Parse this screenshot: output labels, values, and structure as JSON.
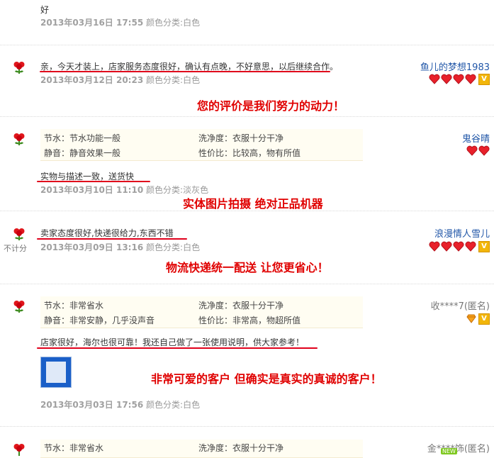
{
  "colors": {
    "promo_red": "#e00000",
    "underline_red": "#e0001b",
    "username_blue": "#2257a8",
    "meta_gray": "#999999"
  },
  "icons": {
    "reviewer_flower": "red-flower-icon",
    "heart_badge": "red-heart-icon",
    "vip_badge": "vip-icon",
    "diamond_badge": "diamond-icon"
  },
  "reviews": [
    {
      "content": "好",
      "date": "2013年03月16日 17:55",
      "color_label": "颜色分类:",
      "color_value": "白色"
    },
    {
      "content": "亲，今天才装上，店家服务态度很好，确认有点晚，不好意思，以后继续合作。",
      "date": "2013年03月12日 20:23",
      "color_label": "颜色分类:",
      "color_value": "白色",
      "user": "鱼儿的梦想1983",
      "promo": "您的评价是我们努力的动力！"
    },
    {
      "attrs": [
        {
          "label": "节水：节水功能一般"
        },
        {
          "label": "洗净度：衣服十分干净"
        },
        {
          "label": "静音：静音效果一般"
        },
        {
          "label": "性价比：比较高，物有所值"
        }
      ],
      "content": "实物与描述一致，送货快",
      "date": "2013年03月10日 11:10",
      "color_label": "颜色分类:",
      "color_value": "淡灰色",
      "user": "鬼谷晴",
      "promo": "实体图片拍摄 绝对正品机器"
    },
    {
      "content": "卖家态度很好,快递很给力,东西不错",
      "date": "2013年03月09日 13:16",
      "color_label": "颜色分类:",
      "color_value": "白色",
      "user": "浪漫情人雪儿",
      "points_note": "不计分",
      "promo": "物流快递统一配送 让您更省心！"
    },
    {
      "attrs": [
        {
          "label": "节水：非常省水"
        },
        {
          "label": "洗净度：衣服十分干净"
        },
        {
          "label": "静音：非常安静，几乎没声音"
        },
        {
          "label": "性价比：非常高，物超所值"
        }
      ],
      "content": "店家很好，海尔也很可靠！我还自己做了一张使用说明，供大家参考！",
      "date": "2013年03月03日 17:56",
      "color_label": "颜色分类:",
      "color_value": "白色",
      "user": "收****7(匿名)",
      "promo": "非常可爱的客户 但确实是真实的真诚的客户！"
    },
    {
      "attrs": [
        {
          "label": "节水：非常省水"
        },
        {
          "label": "洗净度：衣服十分干净"
        }
      ],
      "user": "金****饰(匿名)",
      "new_badge": "NEW"
    }
  ]
}
